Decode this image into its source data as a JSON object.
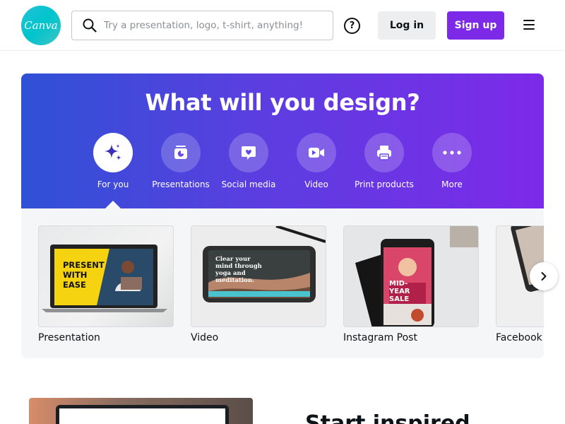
{
  "header": {
    "logo_text": "Canva",
    "search_placeholder": "Try a presentation, logo, t-shirt, anything!",
    "help_label": "?",
    "login_label": "Log in",
    "signup_label": "Sign up"
  },
  "hero": {
    "title": "What will you design?",
    "categories": [
      {
        "label": "For you",
        "icon": "sparkles-icon",
        "active": true
      },
      {
        "label": "Presentations",
        "icon": "presentation-icon",
        "active": false
      },
      {
        "label": "Social media",
        "icon": "heart-chat-icon",
        "active": false
      },
      {
        "label": "Video",
        "icon": "video-camera-icon",
        "active": false
      },
      {
        "label": "Print products",
        "icon": "printer-icon",
        "active": false
      },
      {
        "label": "More",
        "icon": "more-dots-icon",
        "active": false
      }
    ]
  },
  "cards": [
    {
      "label": "Presentation",
      "thumb_text": "PRESENT WITH EASE"
    },
    {
      "label": "Video",
      "thumb_text": "Clear your mind through yoga and meditation."
    },
    {
      "label": "Instagram Post",
      "thumb_text": "MID-YEAR SALE"
    },
    {
      "label": "Facebook"
    }
  ],
  "bottom": {
    "heading": "Start inspired"
  },
  "colors": {
    "brand_purple": "#7d2ae8",
    "hero_start": "#2f51d6",
    "logo_teal": "#00c4cc"
  }
}
